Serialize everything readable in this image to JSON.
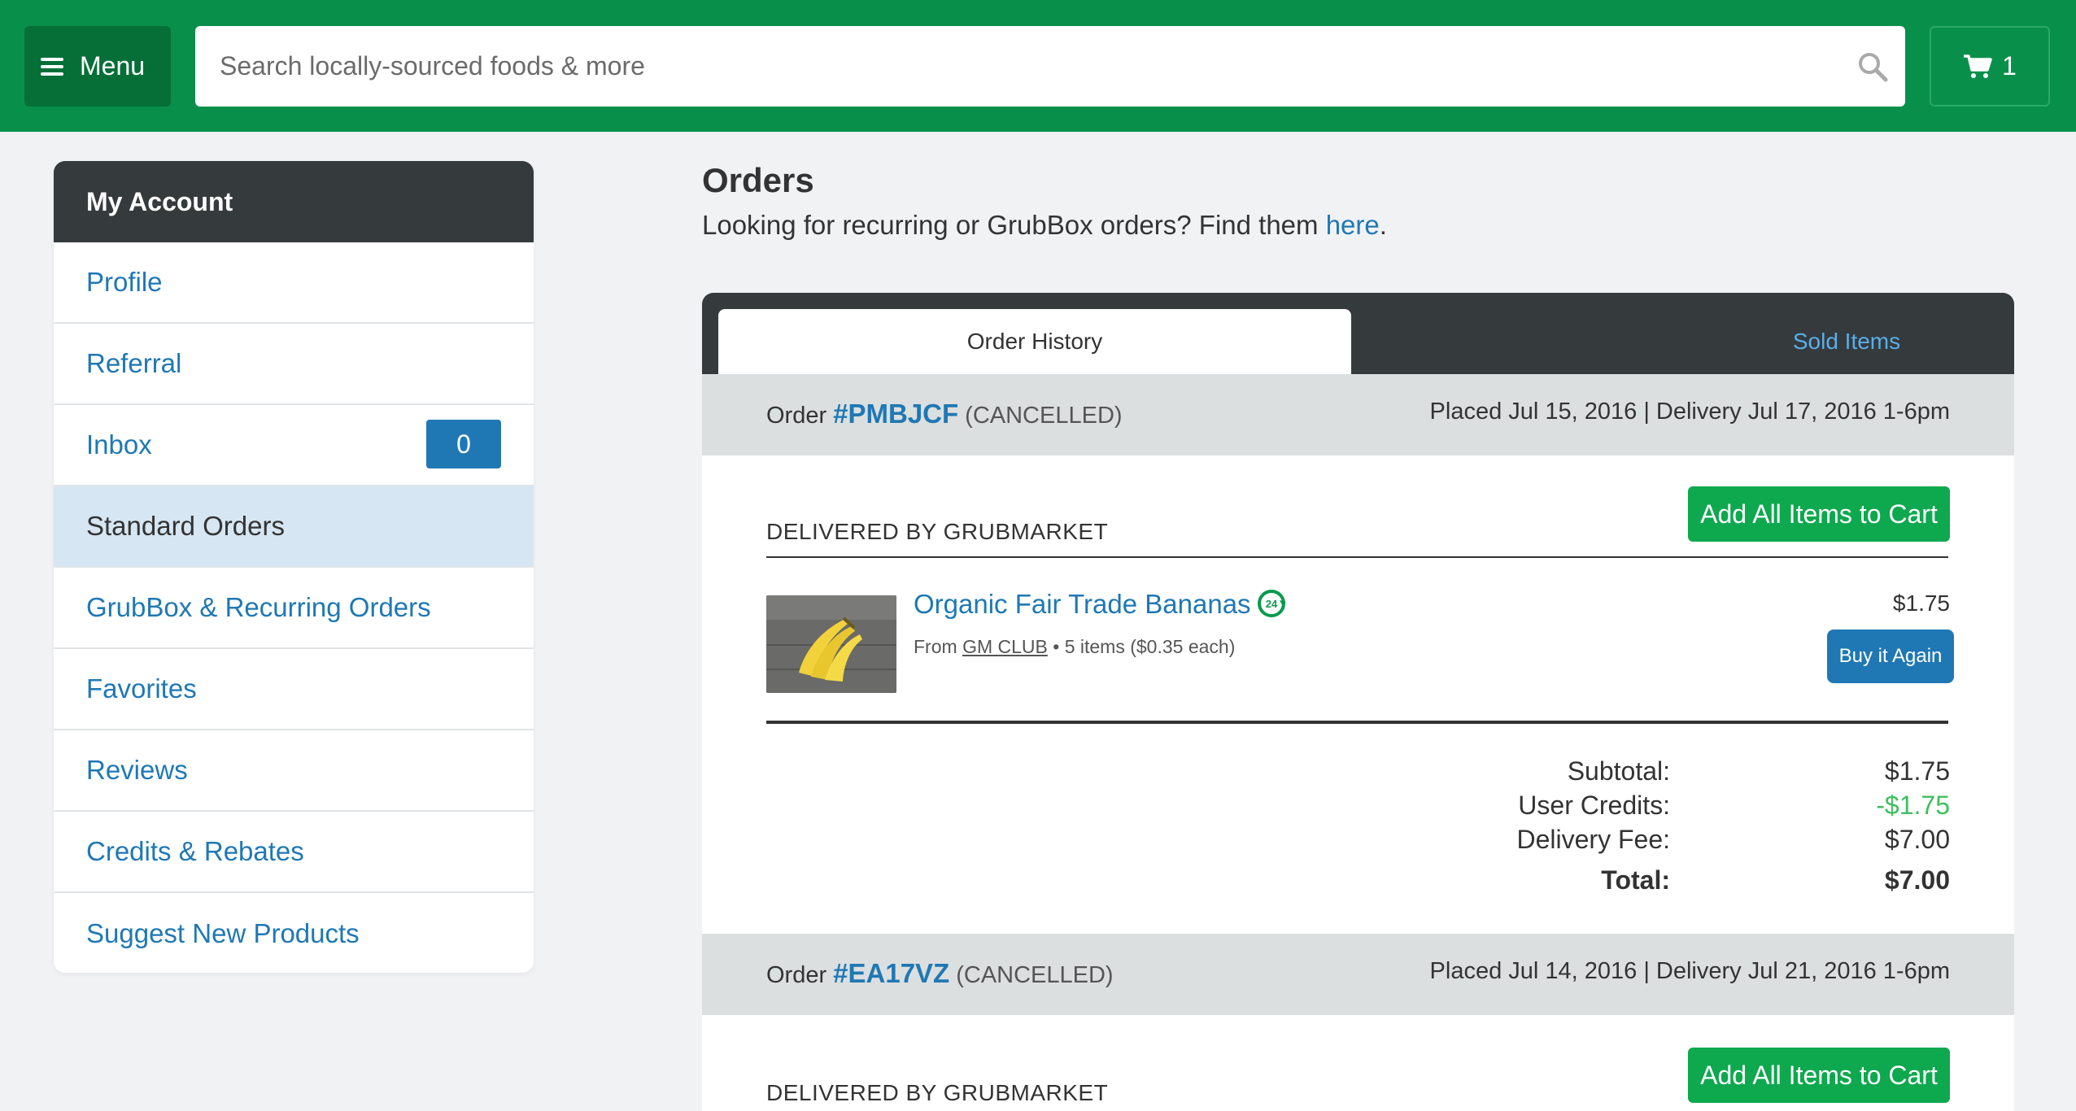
{
  "header": {
    "menu_label": "Menu",
    "search_placeholder": "Search locally-sourced foods & more",
    "cart_count": "1"
  },
  "sidebar": {
    "title": "My Account",
    "items": [
      {
        "label": "Profile"
      },
      {
        "label": "Referral"
      },
      {
        "label": "Inbox",
        "badge": "0"
      },
      {
        "label": "Standard Orders",
        "active": true
      },
      {
        "label": "GrubBox & Recurring Orders"
      },
      {
        "label": "Favorites"
      },
      {
        "label": "Reviews"
      },
      {
        "label": "Credits & Rebates"
      },
      {
        "label": "Suggest New Products"
      }
    ]
  },
  "main": {
    "title": "Orders",
    "subtitle_prefix": "Looking for recurring or GrubBox orders? Find them ",
    "subtitle_link": "here",
    "subtitle_suffix": ".",
    "tabs": [
      {
        "label": "Order History",
        "active": true
      },
      {
        "label": "Sold Items",
        "active": false
      }
    ]
  },
  "orders": [
    {
      "order_prefix": "Order",
      "id": "#PMBJCF",
      "status": "(CANCELLED)",
      "dates": "Placed Jul 15, 2016 | Delivery Jul 17, 2016 1-6pm",
      "delivered_by": "DELIVERED BY GRUBMARKET",
      "add_all_label": "Add All Items to Cart",
      "items": [
        {
          "name": "Organic Fair Trade Bananas",
          "from_label": "From",
          "vendor": "GM CLUB",
          "detail": " • 5 items ($0.35 each)",
          "price": "$1.75",
          "buy_again_label": "Buy it Again"
        }
      ],
      "totals": {
        "subtotal_label": "Subtotal:",
        "subtotal": "$1.75",
        "credits_label": "User Credits:",
        "credits": "-$1.75",
        "delivery_label": "Delivery Fee:",
        "delivery": "$7.00",
        "total_label": "Total:",
        "total": "$7.00"
      }
    },
    {
      "order_prefix": "Order",
      "id": "#EA17VZ",
      "status": "(CANCELLED)",
      "dates": "Placed Jul 14, 2016 | Delivery Jul 21, 2016 1-6pm",
      "delivered_by": "DELIVERED BY GRUBMARKET",
      "add_all_label": "Add All Items to Cart"
    }
  ],
  "colors": {
    "brand_green": "#08904a",
    "link_blue": "#1f78b4",
    "button_green": "#0ea84e",
    "credit_green": "#3fbf5f",
    "dark_header": "#353a3d"
  }
}
